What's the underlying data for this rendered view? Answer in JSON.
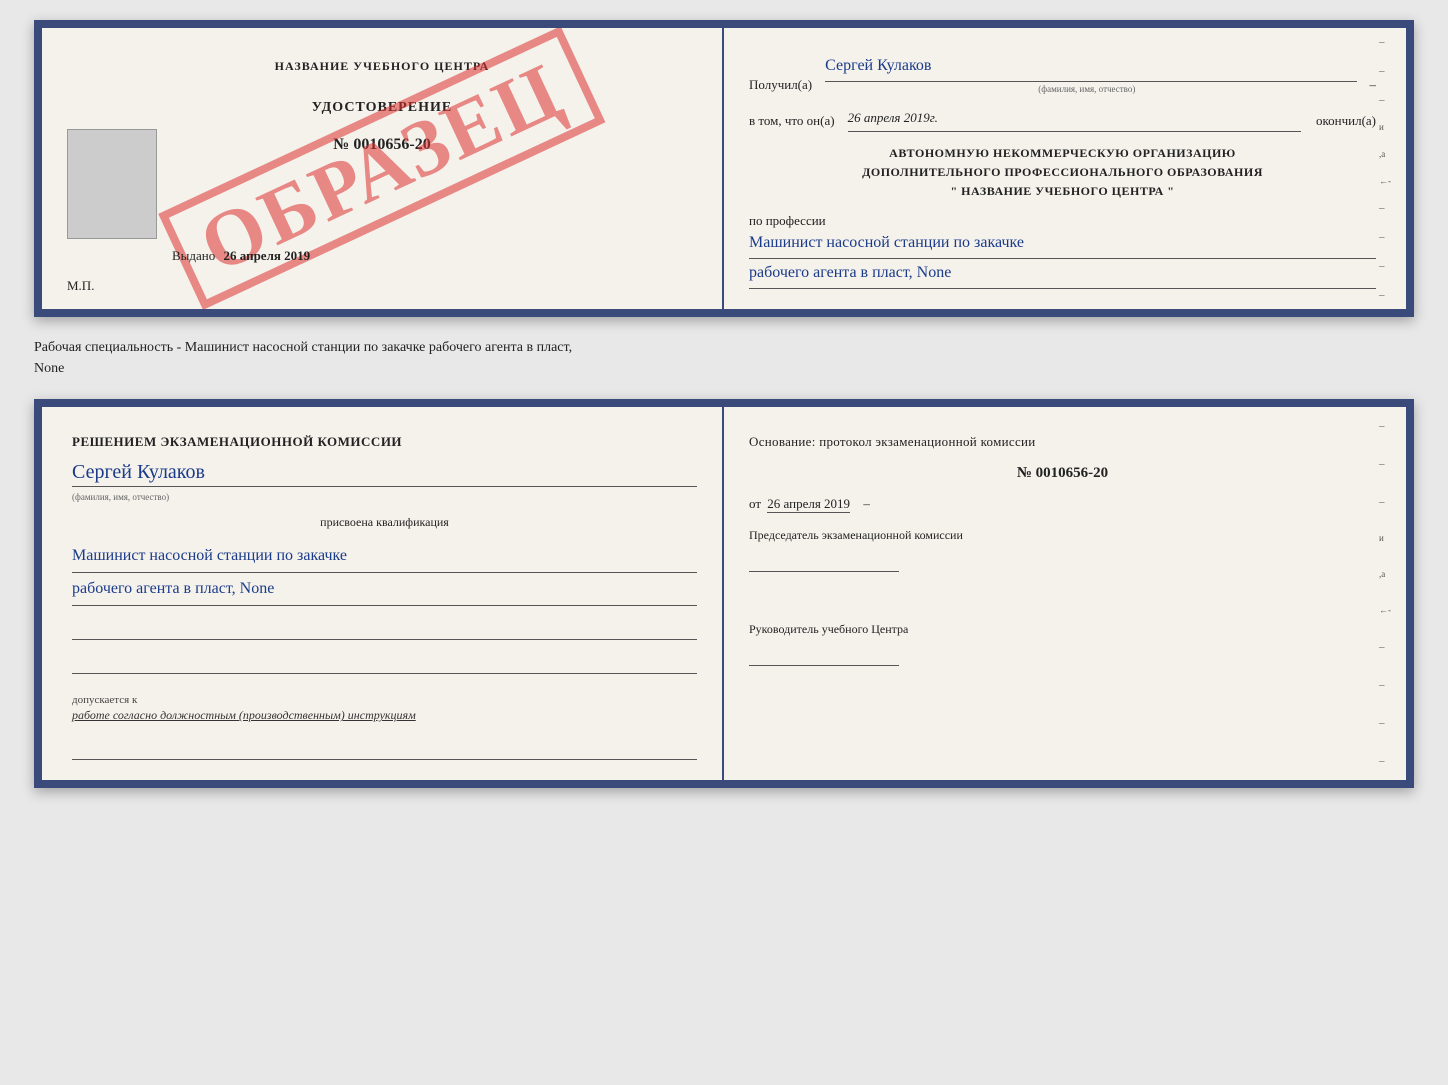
{
  "top_doc": {
    "left": {
      "training_center_title": "НАЗВАНИЕ УЧЕБНОГО ЦЕНТРА",
      "certificate_type": "УДОСТОВЕРЕНИЕ",
      "certificate_number": "№ 0010656-20",
      "stamp_text": "ОБРАЗЕЦ",
      "issued_label": "Выдано",
      "issued_date": "26 апреля 2019",
      "mp_label": "М.П."
    },
    "right": {
      "received_label": "Получил(а)",
      "received_name": "Сергей Кулаков",
      "name_hint": "(фамилия, имя, отчество)",
      "date_label": "в том, что он(а)",
      "date_value": "26 апреля 2019г.",
      "finished_label": "окончил(а)",
      "org_line1": "АВТОНОМНУЮ НЕКОММЕРЧЕСКУЮ ОРГАНИЗАЦИЮ",
      "org_line2": "ДОПОЛНИТЕЛЬНОГО ПРОФЕССИОНАЛЬНОГО ОБРАЗОВАНИЯ",
      "org_line3": "\"  НАЗВАНИЕ УЧЕБНОГО ЦЕНТРА  \"",
      "profession_label": "по профессии",
      "profession_line1": "Машинист насосной станции по закачке",
      "profession_line2": "рабочего агента в пласт, None"
    }
  },
  "middle_text": "Рабочая специальность - Машинист насосной станции по закачке рабочего агента в пласт,",
  "middle_text2": "None",
  "bottom_doc": {
    "left": {
      "commission_title": "Решением  экзаменационной  комиссии",
      "person_name": "Сергей Кулаков",
      "name_hint": "(фамилия, имя, отчество)",
      "assigned_text": "присвоена квалификация",
      "qualification_line1": "Машинист насосной станции по закачке",
      "qualification_line2": "рабочего агента в пласт, None",
      "допускается_label": "допускается к",
      "допускается_value": "работе согласно должностным (производственным) инструкциям"
    },
    "right": {
      "basis_label": "Основание: протокол экзаменационной  комиссии",
      "protocol_number": "№  0010656-20",
      "date_prefix": "от",
      "date_value": "26 апреля 2019",
      "chairman_label": "Председатель экзаменационной комиссии",
      "head_label": "Руководитель учебного Центра"
    }
  }
}
